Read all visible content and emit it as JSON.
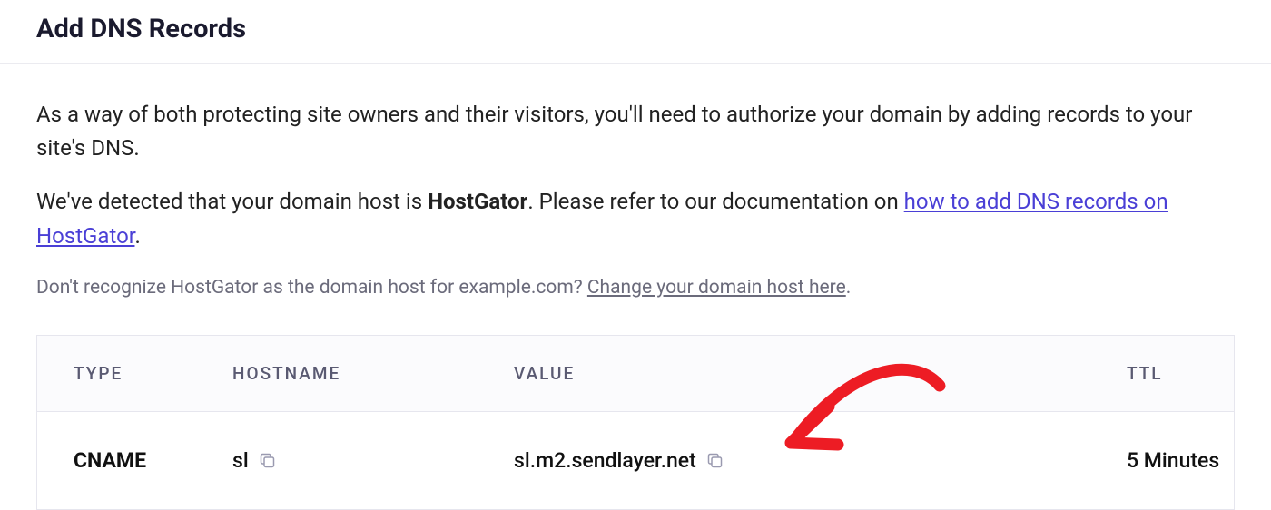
{
  "heading": "Add DNS Records",
  "intro": "As a way of both protecting site owners and their visitors, you'll need to authorize your domain by adding records to your site's DNS.",
  "detected_prefix": "We've detected that your domain host is ",
  "detected_host": "HostGator",
  "detected_suffix": ". Please refer to our documentation on ",
  "doc_link_text": "how to add DNS records on HostGator",
  "doc_period": ".",
  "muted_prefix": "Don't recognize HostGator as the domain host for example.com? ",
  "muted_link": "Change your domain host here",
  "muted_period": ".",
  "table": {
    "headers": {
      "type": "TYPE",
      "hostname": "HOSTNAME",
      "value": "VALUE",
      "ttl": "TTL"
    },
    "row": {
      "type": "CNAME",
      "hostname": "sl",
      "value": "sl.m2.sendlayer.net",
      "ttl": "5 Minutes"
    }
  }
}
